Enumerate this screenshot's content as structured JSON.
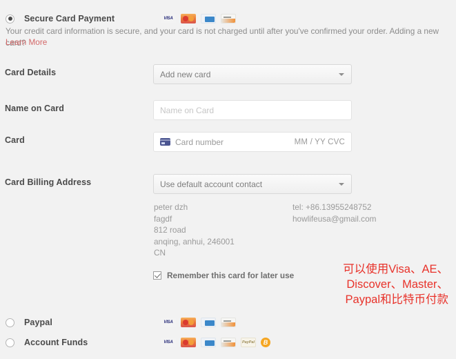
{
  "payment_methods": [
    {
      "id": "secure-card-payment",
      "label": "Secure Card Payment",
      "selected": true,
      "icons": [
        "visa-icon",
        "mastercard-icon",
        "amex-icon",
        "discover-icon"
      ]
    },
    {
      "id": "paypal",
      "label": "Paypal",
      "selected": false,
      "icons": [
        "visa-icon",
        "mastercard-icon",
        "amex-icon",
        "discover-icon"
      ]
    },
    {
      "id": "account-funds",
      "label": "Account Funds",
      "selected": false,
      "icons": [
        "visa-icon",
        "mastercard-icon",
        "amex-icon",
        "discover-icon",
        "paypal-icon",
        "bitcoin-icon"
      ]
    }
  ],
  "description": {
    "text": "Your credit card information is secure, and your card is not charged until after you've confirmed your order. Adding a new card?",
    "link_label": "Learn More",
    "link_color": "#d4696a"
  },
  "form": {
    "card_details": {
      "label": "Card Details",
      "selected_option": "Add new card"
    },
    "name_on_card": {
      "label": "Name on Card",
      "value": "",
      "placeholder": "Name on Card"
    },
    "card": {
      "label": "Card",
      "number_placeholder": "Card number",
      "expiry_cvc_placeholder": "MM / YY  CVC"
    },
    "billing_address": {
      "label": "Card Billing Address",
      "selected_option": "Use default account contact",
      "contact_lines": [
        "peter dzh",
        "fagdf",
        "812 road",
        "anqing, anhui, 246001",
        "CN"
      ],
      "phone": "tel: +86.13955248752",
      "email": "howlifeusa@gmail.com"
    },
    "remember_card": {
      "label": "Remember this card for later use",
      "checked": true
    }
  },
  "annotation": {
    "color": "#e8322a",
    "lines": [
      "可以使用Visa、AE、",
      "Discover、Master、",
      "Paypal和比特币付款"
    ]
  },
  "icon_labels": {
    "visa": "VISA",
    "paypal": "PayPal",
    "bitcoin": "B"
  }
}
